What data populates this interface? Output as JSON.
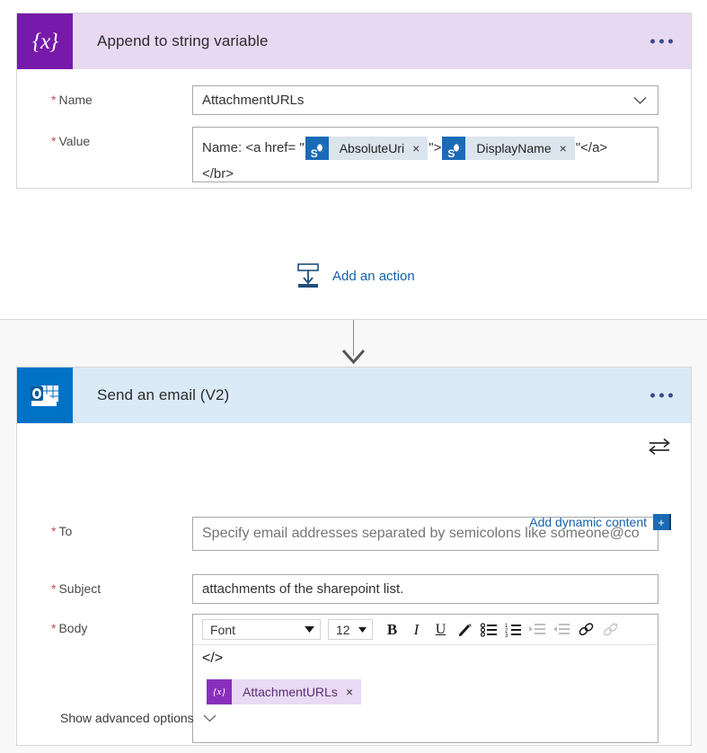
{
  "append_card": {
    "icon": "variable-braces-icon",
    "title": "Append to string variable",
    "menu": "ellipsis-menu",
    "name_field": {
      "label": "Name",
      "required": "*",
      "value": "AttachmentURLs",
      "chevron": "chevron-down-icon"
    },
    "value_field": {
      "label": "Value",
      "required": "*",
      "text_1": "Name: <a href= \"",
      "token_1": {
        "icon": "sharepoint-icon",
        "label": "AbsoluteUri",
        "remove": "×"
      },
      "text_2": "\">",
      "token_2": {
        "icon": "sharepoint-icon",
        "label": "DisplayName",
        "remove": "×"
      },
      "text_3": "\"</a>",
      "text_4": "</br>"
    }
  },
  "add_action": {
    "icon": "add-action-icon",
    "label": "Add an action"
  },
  "email_card": {
    "icon": "outlook-icon",
    "title": "Send an email (V2)",
    "menu": "ellipsis-menu",
    "swap_icon": "swap-arrows-icon",
    "to_field": {
      "label": "To",
      "required": "*",
      "placeholder": "Specify email addresses separated by semicolons like someone@co",
      "value": ""
    },
    "dynamic_content": {
      "label": "Add dynamic content",
      "plus": "+"
    },
    "subject_field": {
      "label": "Subject",
      "required": "*",
      "value": "attachments of the sharepoint list."
    },
    "body_field": {
      "label": "Body",
      "required": "*",
      "toolbar": {
        "font_name": "Font",
        "font_size": "12",
        "bold": "B",
        "italic": "I",
        "underline": "U",
        "text_color": "text-color-pen-icon",
        "bulleted_list": "bulleted-list-icon",
        "numbered_list": "numbered-list-icon",
        "indent_increase": "indent-increase-icon",
        "indent_decrease": "indent-decrease-icon",
        "link": "link-icon",
        "unlink": "unlink-icon",
        "code_view": "</>"
      },
      "token": {
        "icon": "variable-braces-icon",
        "label": "AttachmentURLs",
        "remove": "×"
      }
    },
    "advanced": {
      "label": "Show advanced options",
      "chevron": "chevron-down-icon"
    }
  },
  "colors": {
    "variable_purple": "#7719aa",
    "variable_header": "#e8d9f3",
    "outlook_blue": "#0072c6",
    "outlook_header": "#dbeaf7",
    "link_blue": "#1560a8",
    "required_red": "#c2504f",
    "token_chip": "#dbe5ee"
  }
}
